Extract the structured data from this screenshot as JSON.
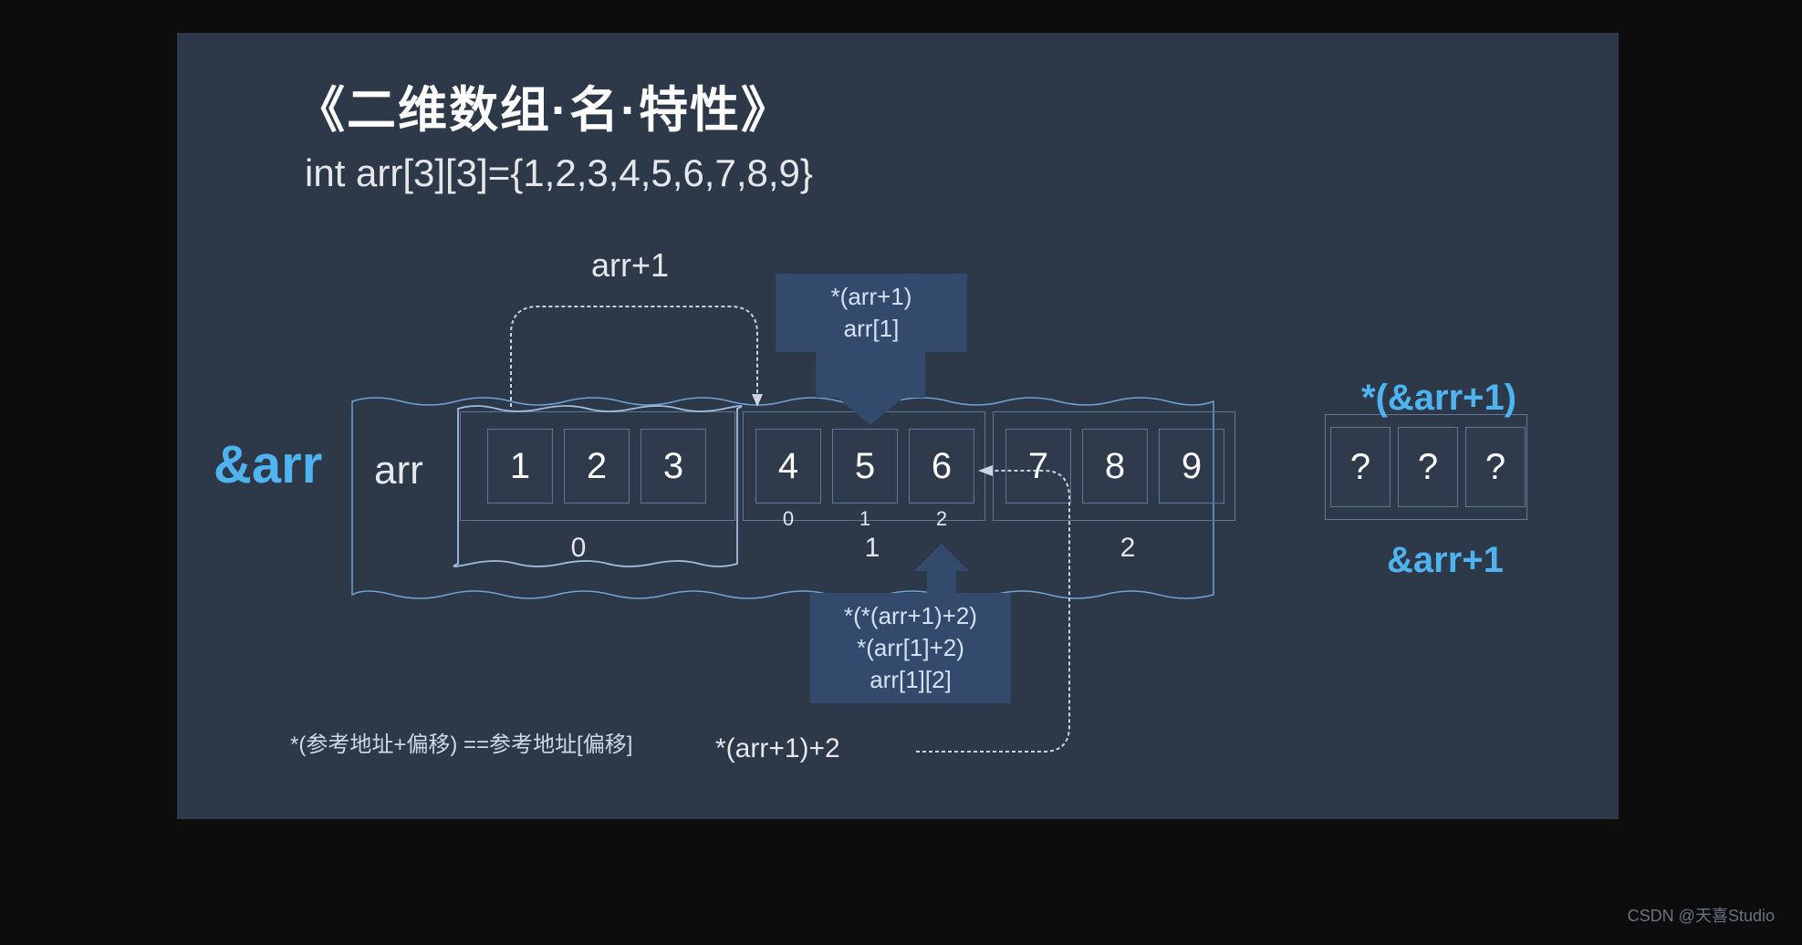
{
  "title": "《二维数组·名·特性》",
  "declaration": "int arr[3][3]={1,2,3,4,5,6,7,8,9}",
  "labels": {
    "amp_arr": "&arr",
    "arr": "arr",
    "arr_plus1": "arr+1",
    "star_arr_plus1": "*(arr+1)",
    "arr_sub1": "arr[1]",
    "star_star": "*(*(arr+1)+2)",
    "star_arr1_2": "*(arr[1]+2)",
    "arr_1_2": "arr[1][2]",
    "after_expr": "*(arr+1)+2",
    "note": "*(参考地址+偏移) ==参考地址[偏移]",
    "star_amp_arr_plus1": "*(&arr+1)",
    "amp_arr_plus1": "&arr+1"
  },
  "rows": [
    {
      "cells": [
        "1",
        "2",
        "3"
      ],
      "big_index": "0"
    },
    {
      "cells": [
        "4",
        "5",
        "6"
      ],
      "big_index": "1",
      "sub_indices": [
        "0",
        "1",
        "2"
      ]
    },
    {
      "cells": [
        "7",
        "8",
        "9"
      ],
      "big_index": "2"
    }
  ],
  "extra_cells": [
    "?",
    "?",
    "?"
  ],
  "watermark": "CSDN @天喜Studio"
}
